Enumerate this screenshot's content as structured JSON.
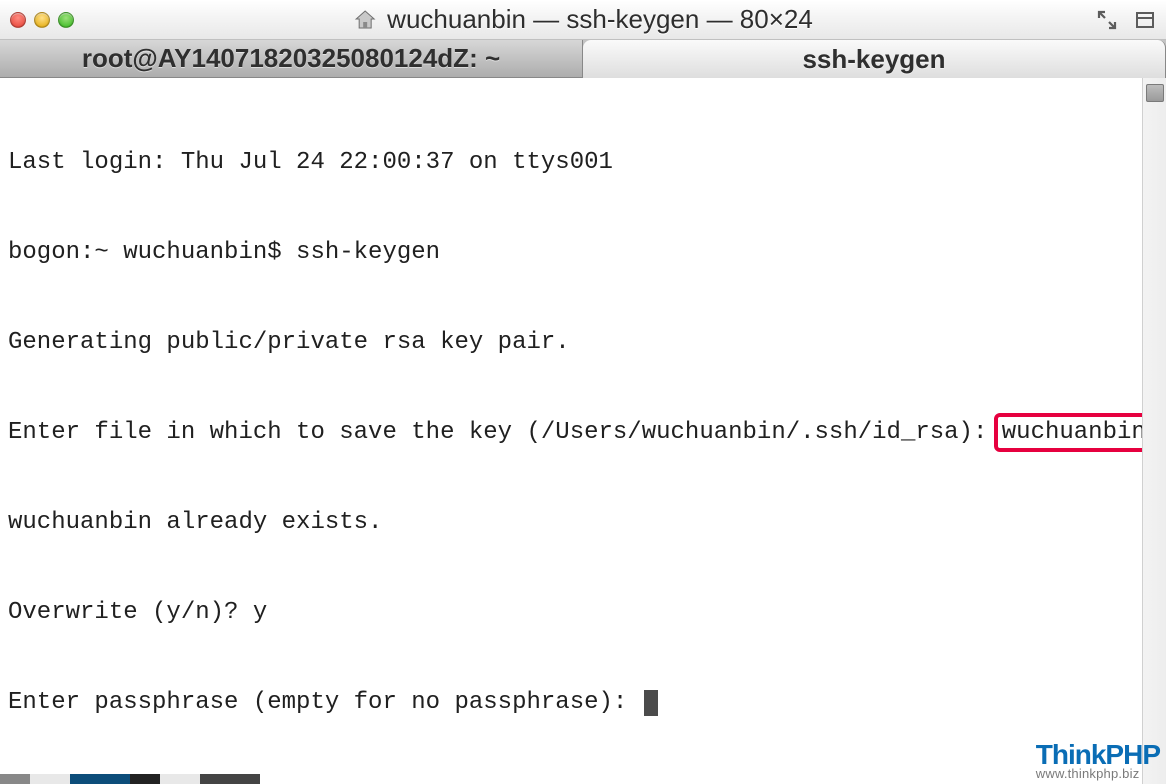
{
  "window": {
    "title": "wuchuanbin — ssh-keygen — 80×24"
  },
  "tabs": {
    "left": "root@AY14071820325080124dZ: ~",
    "right": "ssh-keygen"
  },
  "terminal": {
    "line1": "Last login: Thu Jul 24 22:00:37 on ttys001",
    "prompt": "bogon:~ wuchuanbin$ ",
    "command": "ssh-keygen",
    "line3": "Generating public/private rsa key pair.",
    "line4_prefix": "Enter file in which to save the key (/Users/wuchuanbin/.ssh/id_rsa): ",
    "line4_input": "wuchuanbin",
    "line5": "wuchuanbin already exists.",
    "line6_prefix": "Overwrite (y/n)? ",
    "line6_input": "y",
    "line7": "Enter passphrase (empty for no passphrase): "
  },
  "watermark": {
    "brand": "ThinkPHP",
    "url": "www.thinkphp.biz"
  }
}
